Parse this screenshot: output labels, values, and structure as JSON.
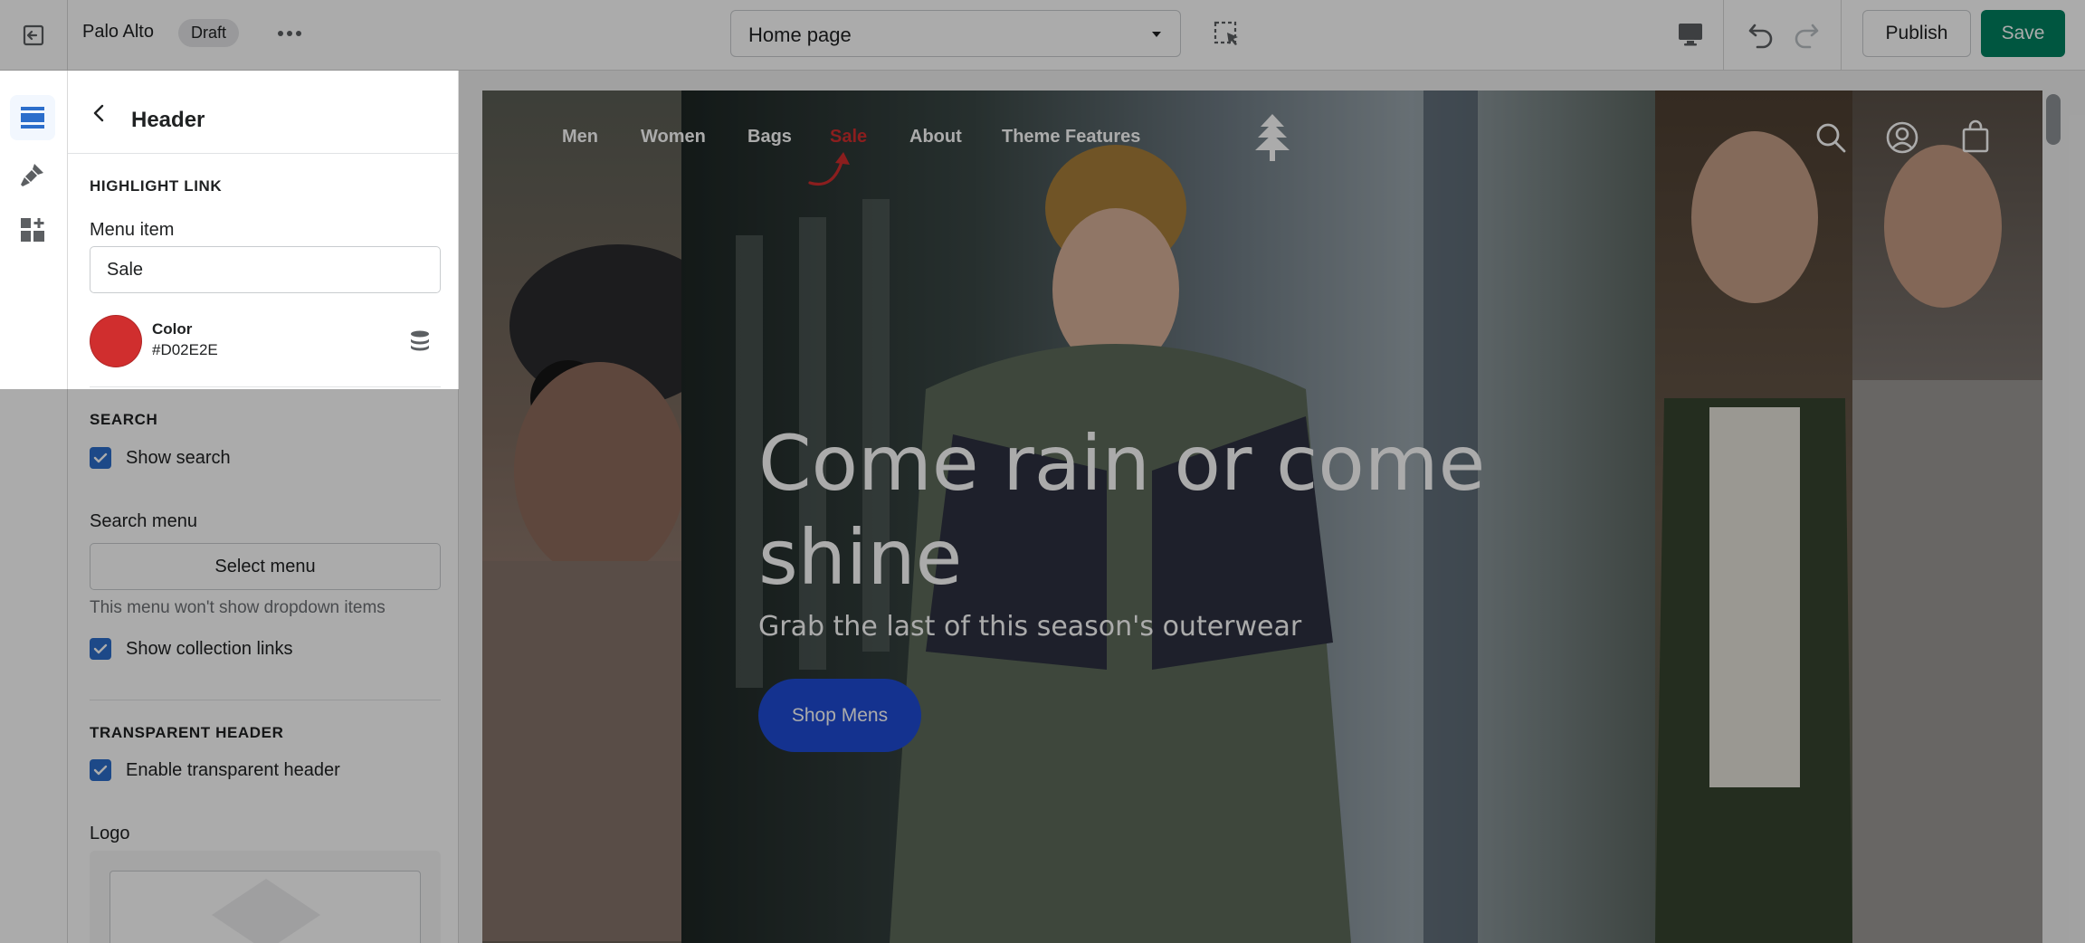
{
  "topbar": {
    "store_name": "Palo Alto",
    "status_badge": "Draft",
    "page_selector": "Home page",
    "publish_label": "Publish",
    "save_label": "Save"
  },
  "rail": {
    "items": [
      {
        "icon": "sections-icon",
        "active": true
      },
      {
        "icon": "theme-settings-brush-icon",
        "active": false
      },
      {
        "icon": "apps-blocks-icon",
        "active": false
      }
    ]
  },
  "panel": {
    "title": "Header",
    "highlight": {
      "section_title": "HIGHLIGHT LINK",
      "menu_item_label": "Menu item",
      "menu_item_value": "Sale",
      "color_label": "Color",
      "color_hex": "#D02E2E",
      "color_value": "#D02E2E"
    },
    "search": {
      "section_title": "SEARCH",
      "show_search_label": "Show search",
      "show_search_checked": true,
      "search_menu_label": "Search menu",
      "select_menu_button": "Select menu",
      "help_text": "This menu won't show dropdown items",
      "show_collection_links_label": "Show collection links",
      "show_collection_links_checked": true
    },
    "transparent": {
      "section_title": "TRANSPARENT HEADER",
      "enable_label": "Enable transparent header",
      "enable_checked": true,
      "logo_label": "Logo"
    }
  },
  "preview": {
    "nav": [
      "Men",
      "Women",
      "Bags",
      "Sale",
      "About",
      "Theme Features"
    ],
    "highlighted_nav": "Sale",
    "hero_title": "Come rain or come shine",
    "hero_subtitle": "Grab the last of this season's outerwear",
    "hero_button": "Shop Mens"
  },
  "colors": {
    "accent_green": "#008060",
    "highlight_red": "#D02E2E",
    "hero_button_blue": "#1F4BD6",
    "checkbox_blue": "#2C6ECB"
  }
}
